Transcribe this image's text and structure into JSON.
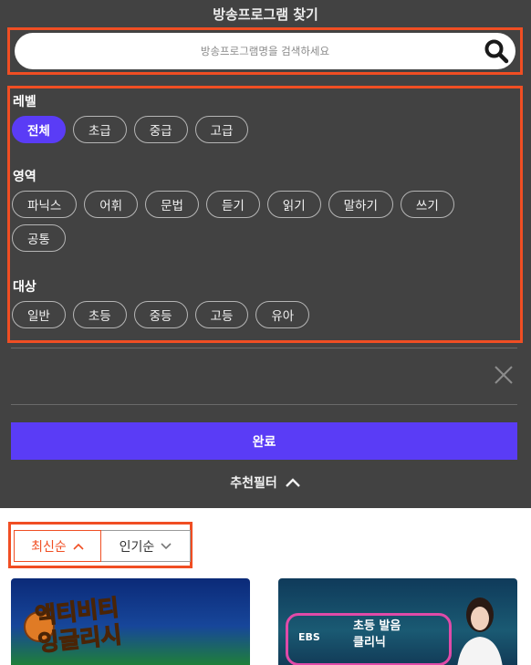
{
  "header": {
    "title": "방송프로그램 찾기"
  },
  "search": {
    "placeholder": "방송프로그램명을 검색하세요"
  },
  "filters": {
    "level": {
      "label": "레벨",
      "options": [
        "전체",
        "초급",
        "중급",
        "고급"
      ],
      "selected": "전체"
    },
    "area": {
      "label": "영역",
      "options": [
        "파닉스",
        "어휘",
        "문법",
        "듣기",
        "읽기",
        "말하기",
        "쓰기",
        "공통"
      ]
    },
    "target": {
      "label": "대상",
      "options": [
        "일반",
        "초등",
        "중등",
        "고등",
        "유아"
      ]
    }
  },
  "actions": {
    "done_label": "완료",
    "recommend_filter_label": "추천필터"
  },
  "sort": {
    "latest_label": "최신순",
    "popular_label": "인기순",
    "active": "latest"
  },
  "cards": [
    {
      "title_line1": "액티비티",
      "title_line2": "잉글리시"
    },
    {
      "logo": "EBS",
      "title_line1": "초등 발음",
      "title_line2": "클리닉"
    }
  ],
  "colors": {
    "panel_bg": "#424242",
    "accent_purple": "#5a3cf6",
    "highlight_orange": "#f04e23"
  }
}
